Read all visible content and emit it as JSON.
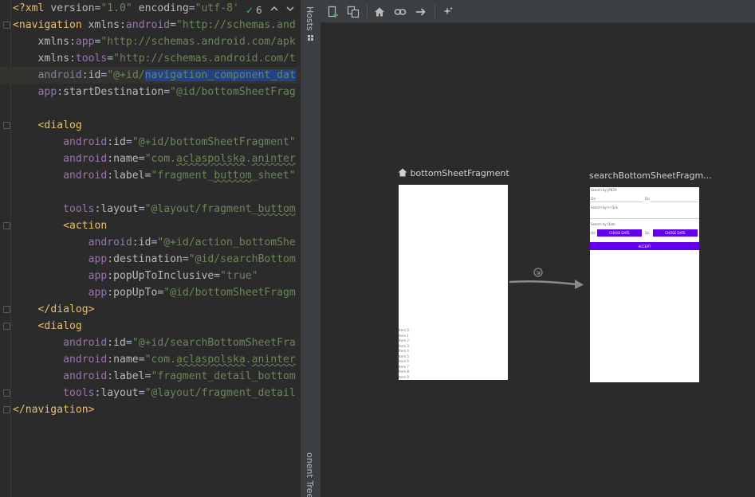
{
  "editor": {
    "inspection": {
      "count": "6"
    },
    "lines": [
      {
        "segments": [
          [
            "c-tag",
            "<?xml "
          ],
          [
            "c-attr",
            "version"
          ],
          [
            "",
            "="
          ],
          [
            "c-val",
            "\"1.0\""
          ],
          [
            "c-attr",
            " encoding"
          ],
          [
            "",
            "="
          ],
          [
            "c-val",
            "\"utf-8'"
          ]
        ]
      },
      {
        "segments": [
          [
            "c-tag",
            "<navigation "
          ],
          [
            "c-attr",
            "xmlns:"
          ],
          [
            "c-ns",
            "android"
          ],
          [
            "",
            "="
          ],
          [
            "c-val",
            "\"http://schemas.and"
          ]
        ]
      },
      {
        "segments": [
          [
            "",
            "    "
          ],
          [
            "c-attr",
            "xmlns:"
          ],
          [
            "c-ns",
            "app"
          ],
          [
            "",
            "="
          ],
          [
            "c-val",
            "\"http://schemas.android.com/apk"
          ]
        ]
      },
      {
        "segments": [
          [
            "",
            "    "
          ],
          [
            "c-attr",
            "xmlns:"
          ],
          [
            "c-ns",
            "tools"
          ],
          [
            "",
            "="
          ],
          [
            "c-val",
            "\"http://schemas.android.com/t"
          ]
        ]
      },
      {
        "segments": [
          [
            "",
            "    "
          ],
          [
            "c-ns",
            "android"
          ],
          [
            "c-attr",
            ":id"
          ],
          [
            "",
            "="
          ],
          [
            "c-val",
            "\"@+id/"
          ],
          [
            "c-val c-sel",
            "navigation_component_dat"
          ]
        ],
        "current": true
      },
      {
        "segments": [
          [
            "",
            "    "
          ],
          [
            "c-ns",
            "app"
          ],
          [
            "c-attr",
            ":startDestination"
          ],
          [
            "",
            "="
          ],
          [
            "c-val",
            "\"@id/bottomSheetFrag"
          ]
        ]
      },
      {
        "segments": [
          [
            "",
            ""
          ]
        ]
      },
      {
        "segments": [
          [
            "",
            "    "
          ],
          [
            "c-tag",
            "<dialog"
          ]
        ]
      },
      {
        "segments": [
          [
            "",
            "        "
          ],
          [
            "c-ns",
            "android"
          ],
          [
            "c-attr",
            ":id"
          ],
          [
            "",
            "="
          ],
          [
            "c-val",
            "\"@+id/bottomSheetFragment\""
          ]
        ]
      },
      {
        "segments": [
          [
            "",
            "        "
          ],
          [
            "c-ns",
            "android"
          ],
          [
            "c-attr",
            ":name"
          ],
          [
            "",
            "="
          ],
          [
            "c-val",
            "\"com."
          ],
          [
            "c-val c-under",
            "aclaspolska"
          ],
          [
            "c-val",
            "."
          ],
          [
            "c-val c-under",
            "aninter"
          ]
        ]
      },
      {
        "segments": [
          [
            "",
            "        "
          ],
          [
            "c-ns",
            "android"
          ],
          [
            "c-attr",
            ":label"
          ],
          [
            "",
            "="
          ],
          [
            "c-val",
            "\"fragment_"
          ],
          [
            "c-val c-under",
            "buttom"
          ],
          [
            "c-val",
            "_sheet\""
          ]
        ]
      },
      {
        "segments": [
          [
            "",
            ""
          ]
        ]
      },
      {
        "segments": [
          [
            "",
            "        "
          ],
          [
            "c-ns",
            "tools"
          ],
          [
            "c-attr",
            ":layout"
          ],
          [
            "",
            "="
          ],
          [
            "c-val",
            "\"@layout/fragment_"
          ],
          [
            "c-val c-under",
            "buttom"
          ]
        ]
      },
      {
        "segments": [
          [
            "",
            "        "
          ],
          [
            "c-tag",
            "<action"
          ]
        ]
      },
      {
        "segments": [
          [
            "",
            "            "
          ],
          [
            "c-ns",
            "android"
          ],
          [
            "c-attr",
            ":id"
          ],
          [
            "",
            "="
          ],
          [
            "c-val",
            "\"@+id/action_bottomShe"
          ]
        ]
      },
      {
        "segments": [
          [
            "",
            "            "
          ],
          [
            "c-ns",
            "app"
          ],
          [
            "c-attr",
            ":destination"
          ],
          [
            "",
            "="
          ],
          [
            "c-val",
            "\"@id/searchBottom"
          ]
        ]
      },
      {
        "segments": [
          [
            "",
            "            "
          ],
          [
            "c-ns",
            "app"
          ],
          [
            "c-attr",
            ":popUpToInclusive"
          ],
          [
            "",
            "="
          ],
          [
            "c-val",
            "\"true\""
          ]
        ]
      },
      {
        "segments": [
          [
            "",
            "            "
          ],
          [
            "c-ns",
            "app"
          ],
          [
            "c-attr",
            ":popUpTo"
          ],
          [
            "",
            "="
          ],
          [
            "c-val",
            "\"@id/bottomSheetFragm"
          ]
        ]
      },
      {
        "segments": [
          [
            "",
            "    "
          ],
          [
            "c-tag",
            "</dialog>"
          ]
        ]
      },
      {
        "segments": [
          [
            "",
            "    "
          ],
          [
            "c-tag",
            "<dialog"
          ]
        ]
      },
      {
        "segments": [
          [
            "",
            "        "
          ],
          [
            "c-ns",
            "android"
          ],
          [
            "c-attr",
            ":id"
          ],
          [
            "",
            "="
          ],
          [
            "c-val",
            "\"@+id/searchBottomSheetFra"
          ]
        ]
      },
      {
        "segments": [
          [
            "",
            "        "
          ],
          [
            "c-ns",
            "android"
          ],
          [
            "c-attr",
            ":name"
          ],
          [
            "",
            "="
          ],
          [
            "c-val",
            "\"com."
          ],
          [
            "c-val c-under",
            "aclaspolska"
          ],
          [
            "c-val",
            "."
          ],
          [
            "c-val c-under",
            "aninter"
          ]
        ]
      },
      {
        "segments": [
          [
            "",
            "        "
          ],
          [
            "c-ns",
            "android"
          ],
          [
            "c-attr",
            ":label"
          ],
          [
            "",
            "="
          ],
          [
            "c-val",
            "\"fragment_detail_bottom"
          ]
        ]
      },
      {
        "segments": [
          [
            "",
            "        "
          ],
          [
            "c-ns",
            "tools"
          ],
          [
            "c-attr",
            ":layout"
          ],
          [
            "",
            "="
          ],
          [
            "c-val",
            "\"@layout/fragment_detail"
          ]
        ]
      },
      {
        "segments": [
          [
            "c-tag",
            "</navigation>"
          ]
        ]
      }
    ]
  },
  "side_strip": {
    "hosts_label": "Hosts",
    "tree_label": "onent Tree"
  },
  "toolbar": {
    "buttons": [
      {
        "name": "new-destination-icon"
      },
      {
        "name": "duplicate-icon"
      },
      {
        "name": "home-icon"
      },
      {
        "name": "link-icon"
      },
      {
        "name": "arrow-right-icon"
      },
      {
        "name": "magic-wand-icon"
      }
    ]
  },
  "canvas": {
    "fragment1": {
      "label": "bottomSheetFragment",
      "items": [
        "Item 0",
        "Item 1",
        "Item 2",
        "Item 3",
        "Item 4",
        "Item 5",
        "Item 6",
        "Item 7",
        "Item 8",
        "Item 9"
      ]
    },
    "fragment2": {
      "label": "searchBottomSheetFragm...",
      "search_label": "Search by JPK59",
      "od_label": "Od",
      "do_label": "Do",
      "search_in_label": "Search by in Qnk",
      "date_label": "Search by Date",
      "from_label": "Od",
      "to_label": "Do",
      "chose_date_1": "CHOSE DATE",
      "chose_date_2": "CHOSE DATE",
      "accept": "ACCEPT"
    }
  },
  "colors": {
    "accent": "#6200ee",
    "code_string": "#6a8759",
    "code_tag": "#e8bf6a",
    "code_ns": "#9876aa"
  }
}
